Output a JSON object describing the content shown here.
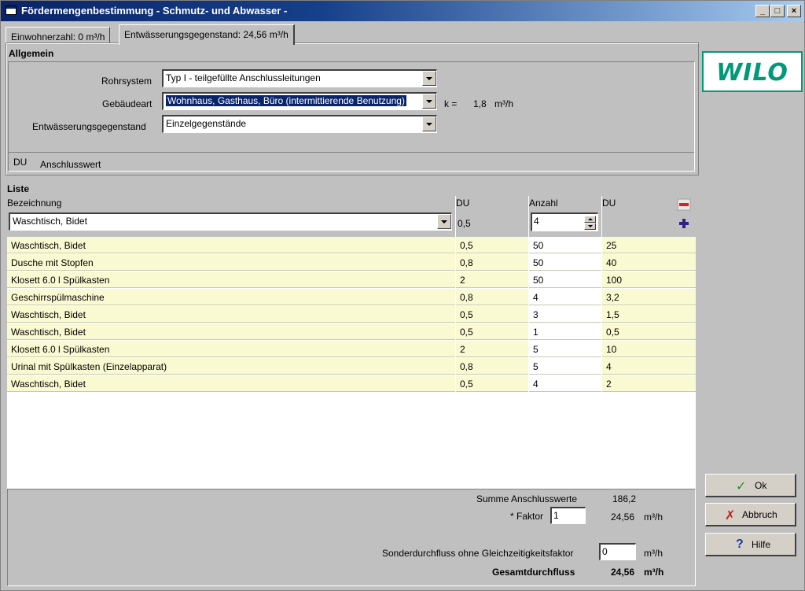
{
  "window": {
    "title": "Fördermengenbestimmung - Schmutz- und Abwasser -",
    "min": "_",
    "max": "□",
    "close": "×"
  },
  "tabs": [
    {
      "label": "Einwohnerzahl:  0 m³/h"
    },
    {
      "label": "Entwässerungsgegenstand:  24,56 m³/h"
    }
  ],
  "allgemein": {
    "title": "Allgemein",
    "rohrsystem_label": "Rohrsystem",
    "rohrsystem_value": "Typ I - teilgefüllte Anschlussleitungen",
    "gebaeudeart_label": "Gebäudeart",
    "gebaeudeart_value": "Wohnhaus, Gasthaus, Büro (intermittierende Benutzung)",
    "k_label": "k =",
    "k_value": "1,8",
    "k_unit": "m³/h",
    "gegenstand_label": "Entwässerungsgegenstand",
    "gegenstand_value": "Einzelgegenstände",
    "du_label": "DU",
    "anschlusswert_label": "Anschlusswert"
  },
  "logo": {
    "text": "WILO",
    "color": "#009a78"
  },
  "liste": {
    "title": "Liste",
    "col_bezeichnung": "Bezeichnung",
    "col_du": "DU",
    "col_anzahl": "Anzahl",
    "col_du2": "DU",
    "input_bezeichnung": "Waschtisch, Bidet",
    "input_du": "0,5",
    "input_anzahl": "4",
    "rows": [
      {
        "name": "Waschtisch, Bidet",
        "du": "0,5",
        "anzahl": "50",
        "total": "25"
      },
      {
        "name": "Dusche mit Stopfen",
        "du": "0,8",
        "anzahl": "50",
        "total": "40"
      },
      {
        "name": "Klosett 6.0 l Spülkasten",
        "du": "2",
        "anzahl": "50",
        "total": "100"
      },
      {
        "name": "Geschirrspülmaschine",
        "du": "0,8",
        "anzahl": "4",
        "total": "3,2"
      },
      {
        "name": "Waschtisch, Bidet",
        "du": "0,5",
        "anzahl": "3",
        "total": "1,5"
      },
      {
        "name": "Waschtisch, Bidet",
        "du": "0,5",
        "anzahl": "1",
        "total": "0,5"
      },
      {
        "name": "Klosett 6.0 l Spülkasten",
        "du": "2",
        "anzahl": "5",
        "total": "10"
      },
      {
        "name": "Urinal mit Spülkasten (Einzelapparat)",
        "du": "0,8",
        "anzahl": "5",
        "total": "4"
      },
      {
        "name": "Waschtisch, Bidet",
        "du": "0,5",
        "anzahl": "4",
        "total": "2"
      }
    ]
  },
  "summary": {
    "summe_label": "Summe Anschlusswerte",
    "summe_value": "186,2",
    "faktor_label": "* Faktor",
    "faktor_value": "1",
    "faktor_result": "24,56",
    "faktor_unit": "m³/h",
    "sonder_label": "Sonderdurchfluss ohne Gleichzeitigkeitsfaktor",
    "sonder_value": "0",
    "sonder_unit": "m³/h",
    "gesamt_label": "Gesamtdurchfluss",
    "gesamt_value": "24,56",
    "gesamt_unit": "m³/h"
  },
  "buttons": {
    "ok": "Ok",
    "abbruch": "Abbruch",
    "hilfe": "Hilfe"
  }
}
